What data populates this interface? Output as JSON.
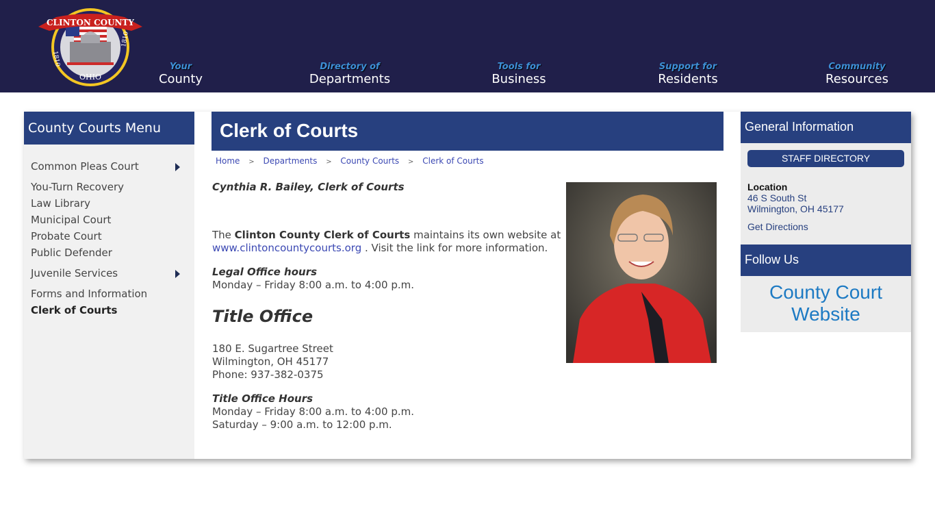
{
  "header": {
    "logo": {
      "banner_text": "CLINTON COUNTY",
      "year_left": "1810",
      "year_right": "1810",
      "state": "OHIO"
    },
    "nav": [
      {
        "sub": "Your",
        "main": "County"
      },
      {
        "sub": "Directory of",
        "main": "Departments"
      },
      {
        "sub": "Tools for",
        "main": "Business"
      },
      {
        "sub": "Support for",
        "main": "Residents"
      },
      {
        "sub": "Community",
        "main": "Resources"
      }
    ]
  },
  "left_nav": {
    "title": "County Courts Menu",
    "items": [
      {
        "label": "Common Pleas Court",
        "has_submenu": true
      },
      {
        "label": "You-Turn Recovery"
      },
      {
        "label": "Law Library"
      },
      {
        "label": "Municipal Court"
      },
      {
        "label": "Probate Court"
      },
      {
        "label": "Public Defender"
      },
      {
        "label": "Juvenile Services",
        "has_submenu": true
      },
      {
        "label": "Forms and Information"
      },
      {
        "label": "Clerk of Courts",
        "active": true
      }
    ]
  },
  "page": {
    "title": "Clerk of Courts",
    "breadcrumb": [
      "Home",
      "Departments",
      "County Courts",
      "Clerk of Courts"
    ],
    "breadcrumb_separator": ">",
    "name_line": "Cynthia R. Bailey, Clerk of Courts",
    "intro": {
      "pre": "The ",
      "bold": "Clinton County Clerk of Courts",
      "mid": " maintains its own website at ",
      "link": "www.clintoncountycourts.org",
      "post": " . Visit the link for more information."
    },
    "legal_hours_heading": "Legal Office hours",
    "legal_hours": "Monday – Friday 8:00 a.m. to 4:00 p.m.",
    "title_office_heading": "Title Office",
    "title_office_address": [
      "180 E. Sugartree Street",
      "Wilmington, OH 45177",
      "Phone: 937-382-0375"
    ],
    "title_hours_heading": "Title Office Hours",
    "title_hours": [
      "Monday – Friday 8:00 a.m. to 4:00 p.m.",
      "Saturday – 9:00 a.m. to 12:00 p.m."
    ],
    "photo_alt": "Cynthia R. Bailey portrait"
  },
  "right": {
    "general_title": "General Information",
    "staff_button": "STAFF DIRECTORY",
    "location_label": "Location",
    "location_lines": [
      "46 S South St",
      "Wilmington, OH 45177"
    ],
    "directions": "Get Directions",
    "follow_title": "Follow Us",
    "court_website": "County Court Website"
  },
  "colors": {
    "header_bg": "#201f4a",
    "accent_blue": "#27407f",
    "nav_sub": "#3d8fd6",
    "link": "#3b48b3",
    "court_link": "#1d7ac3"
  }
}
